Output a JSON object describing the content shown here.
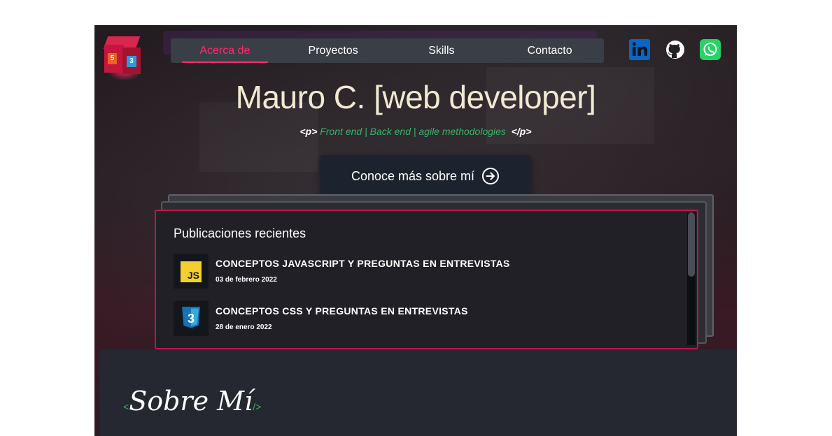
{
  "nav": {
    "items": [
      {
        "label": "Acerca de",
        "active": true
      },
      {
        "label": "Proyectos",
        "active": false
      },
      {
        "label": "Skills",
        "active": false
      },
      {
        "label": "Contacto",
        "active": false
      }
    ]
  },
  "logo": {
    "left_badge": "5",
    "right_badge": "3"
  },
  "social": {
    "linkedin": {
      "icon": "linkedin-icon",
      "color": "#0a66c2"
    },
    "github": {
      "icon": "github-icon",
      "color": "#ffffff"
    },
    "whatsapp": {
      "icon": "whatsapp-icon",
      "color": "#25d366"
    }
  },
  "hero": {
    "title": "Mauro C. [web developer]",
    "tag_open": "<p>",
    "tagline": "Front end | Back end | agile methodologies",
    "tag_close": "</p>",
    "cta_label": "Conoce más sobre mí"
  },
  "recent": {
    "title": "Publicaciones recientes",
    "posts": [
      {
        "title": "CONCEPTOS JAVASCRIPT Y PREGUNTAS EN ENTREVISTAS",
        "date": "03 de febrero 2022",
        "thumb": "JS"
      },
      {
        "title": "CONCEPTOS CSS Y PREGUNTAS EN ENTREVISTAS",
        "date": "28 de enero 2022",
        "thumb": "3"
      }
    ]
  },
  "about": {
    "bracket_open": "<",
    "title": "Sobre Mí",
    "bracket_close": "/>"
  },
  "colors": {
    "accent": "#ff2d6b",
    "green": "#35b36b",
    "card_border": "#c0154a"
  }
}
